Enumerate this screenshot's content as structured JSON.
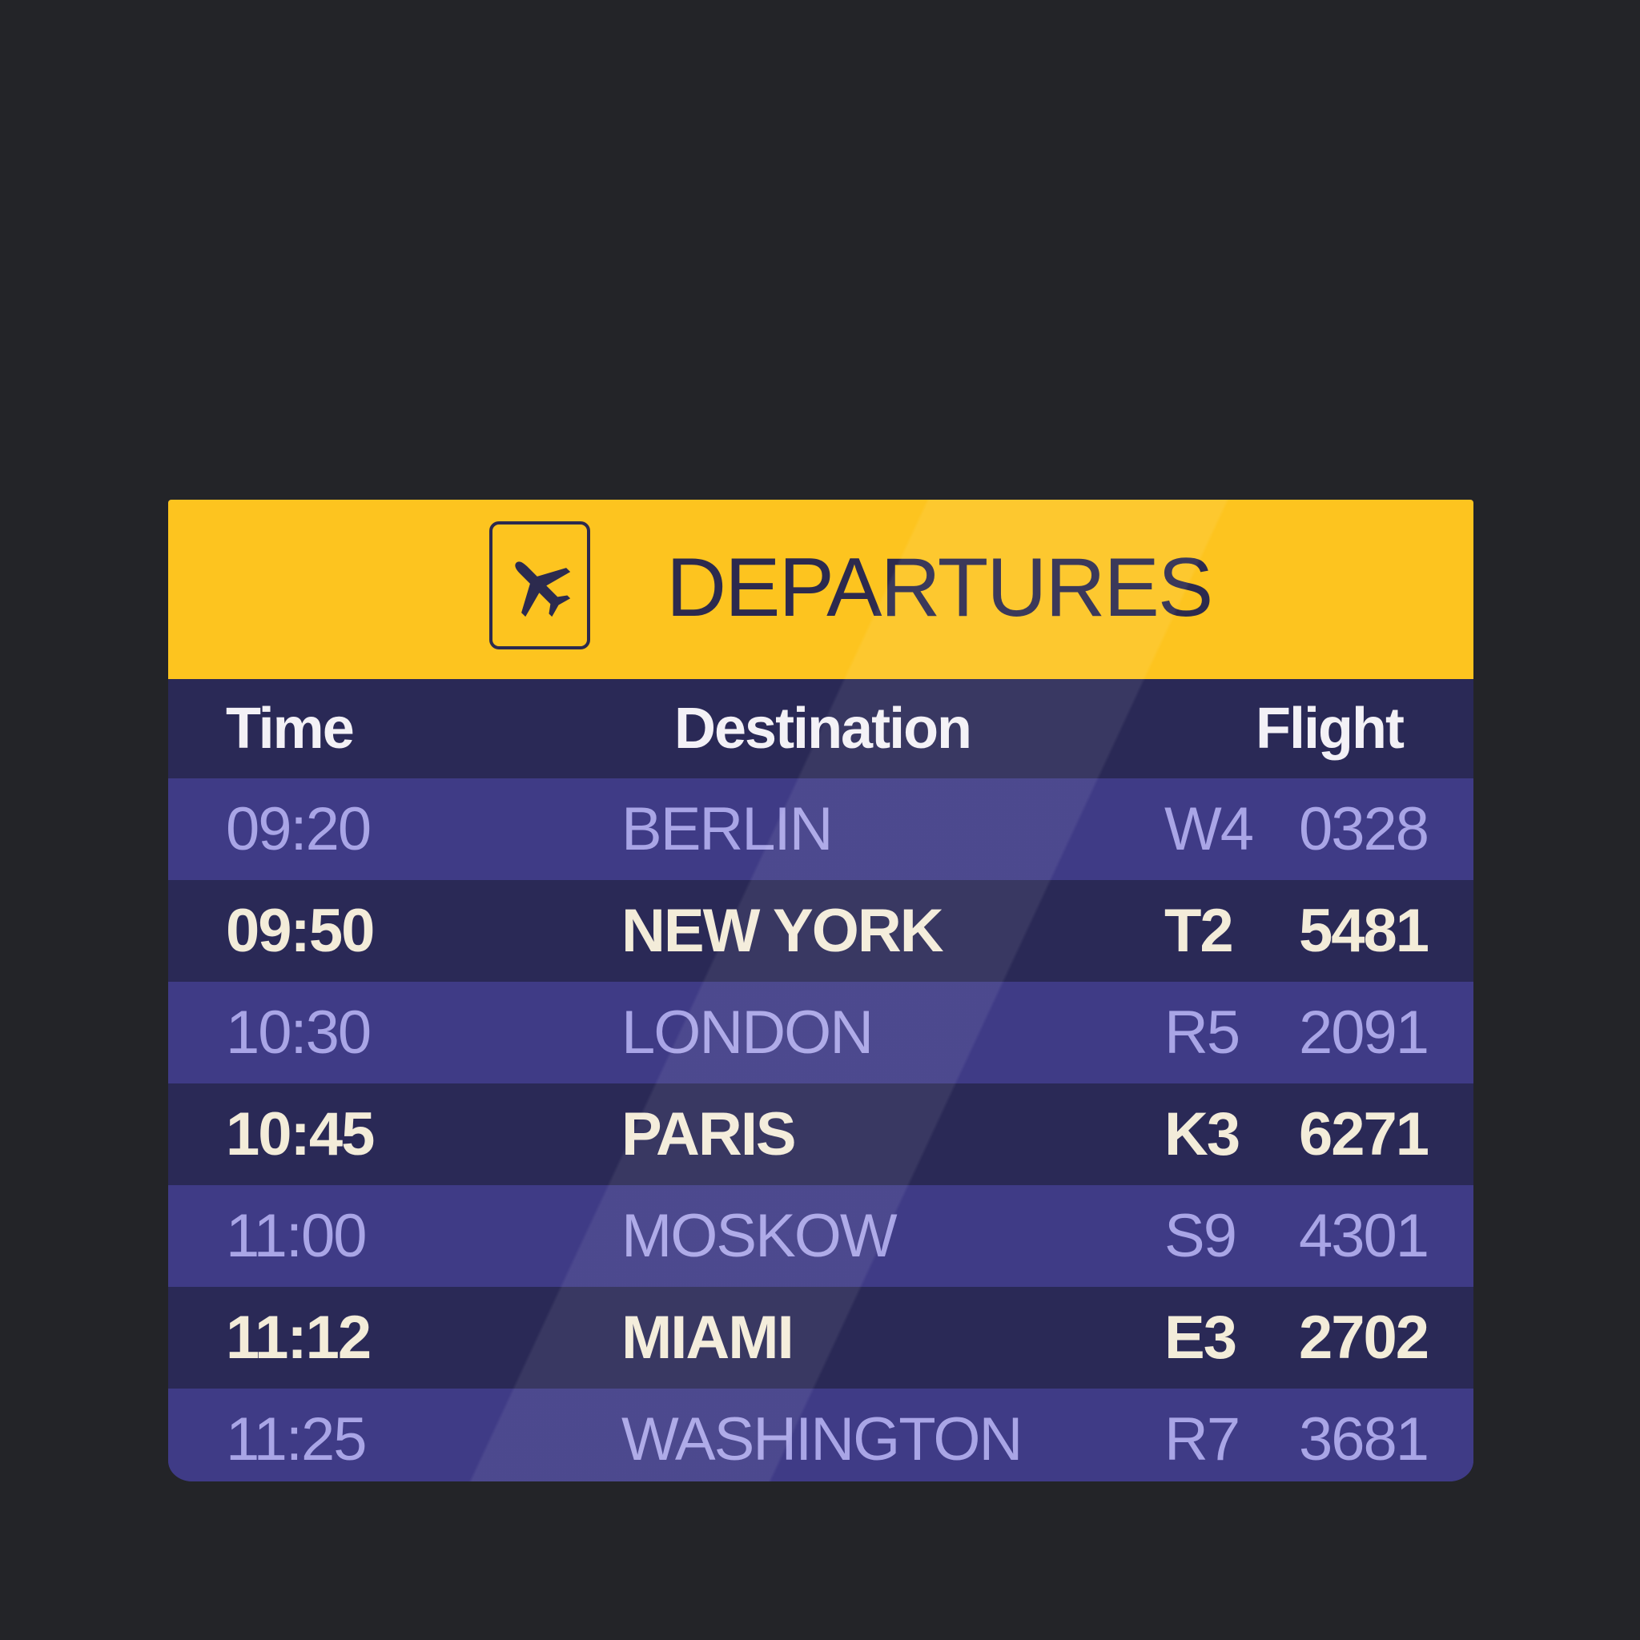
{
  "board": {
    "title": "DEPARTURES",
    "icon": "airplane-icon",
    "colors": {
      "banner": "#fdc41f",
      "dark_row": "#2a2956",
      "light_row": "#3f3b86",
      "title_text": "#2c2a4e"
    },
    "columns": {
      "time": "Time",
      "destination": "Destination",
      "flight": "Flight"
    },
    "rows": [
      {
        "time": "09:20",
        "destination": "BERLIN",
        "code": "W4",
        "number": "0328"
      },
      {
        "time": "09:50",
        "destination": "NEW YORK",
        "code": "T2",
        "number": "5481"
      },
      {
        "time": "10:30",
        "destination": "LONDON",
        "code": "R5",
        "number": "2091"
      },
      {
        "time": "10:45",
        "destination": "PARIS",
        "code": "K3",
        "number": "6271"
      },
      {
        "time": "11:00",
        "destination": "MOSKOW",
        "code": "S9",
        "number": "4301"
      },
      {
        "time": "11:12",
        "destination": "MIAMI",
        "code": "E3",
        "number": "2702"
      },
      {
        "time": "11:25",
        "destination": "WASHINGTON",
        "code": "R7",
        "number": "3681"
      }
    ]
  }
}
